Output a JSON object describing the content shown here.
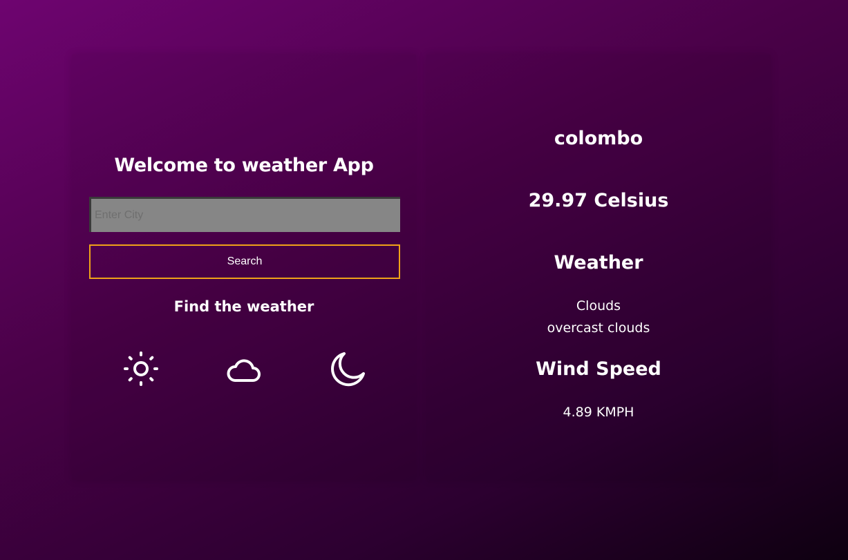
{
  "left_panel": {
    "welcome_title": "Welcome to weather App",
    "search_input": {
      "placeholder": "Enter City",
      "value": ""
    },
    "search_button_label": "Search",
    "find_title": "Find the weather",
    "icons": [
      "sun-icon",
      "cloud-icon",
      "moon-icon"
    ]
  },
  "right_panel": {
    "city": "colombo",
    "temperature": "29.97 Celsius",
    "weather_heading": "Weather",
    "weather_main": "Clouds",
    "weather_description": "overcast clouds",
    "wind_heading": "Wind Speed",
    "wind_speed": "4.89 KMPH"
  },
  "colors": {
    "background_start": "#6e0470",
    "background_end": "#0e0010",
    "button_border": "#f0a318",
    "input_background": "#868686",
    "text": "#ffffff"
  }
}
